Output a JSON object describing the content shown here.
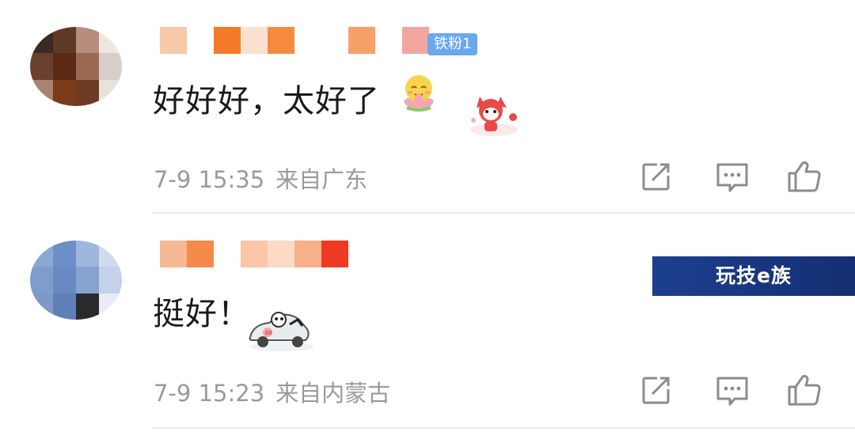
{
  "comments": [
    {
      "fan_badge": "铁粉1",
      "text": "好好好，太好了",
      "emoji_icon": "smiling-lotus-emoji",
      "sticker_icon": "red-cartoon-fox-sticker",
      "time": "7-9 15:35",
      "location": "来自广东",
      "avatar_palette": [
        "#3b2a24",
        "#5e3a26",
        "#b78d7e",
        "#f0e6e0",
        "#6a4030",
        "#5a2a14",
        "#9a6a52",
        "#d8cfcb",
        "#a88470",
        "#7b3a18",
        "#6e3a22",
        "#e8e2df"
      ],
      "username_palette": [
        "#f6c9a8",
        "#ffffff",
        "#f47a2a",
        "#fbe1d0",
        "#f58a3e",
        "#ffffff",
        "#ffffff",
        "#f7a06a",
        "#ffffff",
        "#f3a5a0"
      ]
    },
    {
      "text": "挺好！",
      "sticker_icon": "cartoon-car-sticker",
      "time": "7-9 15:23",
      "location": "来自内蒙古",
      "avatar_palette": [
        "#8aa8d4",
        "#6d8fc8",
        "#9fb6dc",
        "#d0dbee",
        "#7e9ccc",
        "#6a89c0",
        "#86a3d0",
        "#c3d1ea",
        "#7f99c6",
        "#5e7fb8",
        "#2a2a2a",
        "#e8edf5"
      ],
      "username_palette": [
        "#f7b896",
        "#f58a4a",
        "#ffffff",
        "#f9c6a6",
        "#fbdac6",
        "#f7b08a",
        "#ee3a22"
      ]
    }
  ],
  "actions": {
    "share_icon": "share-icon",
    "comment_icon": "comment-icon",
    "like_icon": "thumbs-up-icon"
  },
  "watermark": "玩技e族"
}
